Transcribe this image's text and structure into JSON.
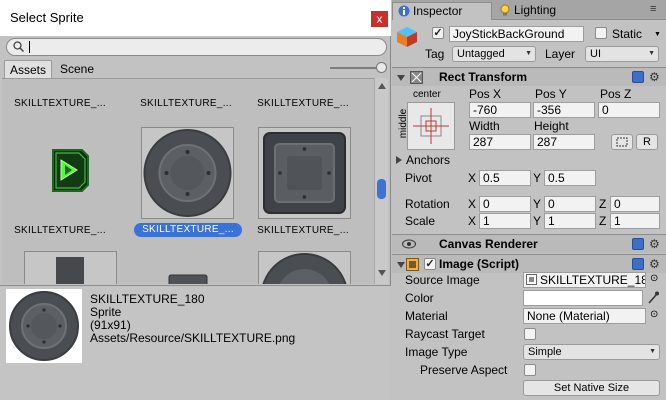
{
  "sprite_window": {
    "title": "Select Sprite",
    "close": "x",
    "search_value": "",
    "tabs": [
      "Assets",
      "Scene"
    ],
    "grid_labels": [
      "SKILLTEXTURE_...",
      "SKILLTEXTURE_...",
      "SKILLTEXTURE_...",
      "SKILLTEXTURE_...",
      "SKILLTEXTURE_...",
      "SKILLTEXTURE_..."
    ],
    "selected_label": "SKILLTEXTURE_...",
    "preview": {
      "name": "SKILLTEXTURE_180",
      "type": "Sprite",
      "size": "(91x91)",
      "path": "Assets/Resource/SKILLTEXTURE.png"
    }
  },
  "inspector": {
    "tabs": [
      "Inspector",
      "Lighting"
    ],
    "object": {
      "active": true,
      "name": "JoyStickBackGround",
      "static_label": "Static",
      "tag_label": "Tag",
      "tag_value": "Untagged",
      "layer_label": "Layer",
      "layer_value": "UI"
    },
    "rect_transform": {
      "title": "Rect Transform",
      "anchor_h": "center",
      "anchor_v": "middle",
      "pos_x_label": "Pos X",
      "pos_x": "-760",
      "pos_y_label": "Pos Y",
      "pos_y": "-356",
      "pos_z_label": "Pos Z",
      "pos_z": "0",
      "width_label": "Width",
      "width": "287",
      "height_label": "Height",
      "height": "287",
      "r_button": "R",
      "anchors_label": "Anchors",
      "pivot_label": "Pivot",
      "pivot": {
        "x": "0.5",
        "y": "0.5"
      },
      "rotation_label": "Rotation",
      "rotation": {
        "x": "0",
        "y": "0",
        "z": "0"
      },
      "scale_label": "Scale",
      "scale": {
        "x": "1",
        "y": "1",
        "z": "1"
      },
      "axis": {
        "x": "X",
        "y": "Y",
        "z": "Z"
      }
    },
    "canvas_renderer": {
      "title": "Canvas Renderer"
    },
    "image": {
      "title": "Image (Script)",
      "enabled": true,
      "source_label": "Source Image",
      "source_value": "SKILLTEXTURE_18",
      "color_label": "Color",
      "material_label": "Material",
      "material_value": "None (Material)",
      "raycast_label": "Raycast Target",
      "image_type_label": "Image Type",
      "image_type_value": "Simple",
      "preserve_label": "Preserve Aspect",
      "native_size_button": "Set Native Size"
    }
  },
  "colors": {
    "selection": "#3a72d8",
    "close_button": "#c9302c",
    "help_icon": "#3c6fc7"
  }
}
